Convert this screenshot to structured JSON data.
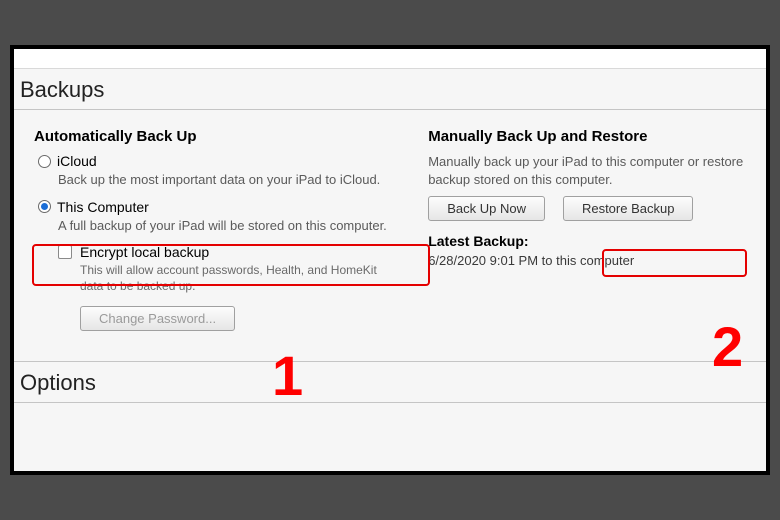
{
  "section_backups": "Backups",
  "section_options": "Options",
  "auto": {
    "heading": "Automatically Back Up",
    "icloud_label": "iCloud",
    "icloud_desc": "Back up the most important data on your iPad to iCloud.",
    "thiscomp_label": "This Computer",
    "thiscomp_desc": "A full backup of your iPad will be stored on this computer.",
    "encrypt_label": "Encrypt local backup",
    "encrypt_desc": "This will allow account passwords, Health, and HomeKit data to be backed up.",
    "change_pw": "Change Password..."
  },
  "manual": {
    "heading": "Manually Back Up and Restore",
    "desc": "Manually back up your iPad to this computer or restore backup stored on this computer.",
    "backup_now": "Back Up Now",
    "restore": "Restore Backup",
    "latest_label": "Latest Backup:",
    "latest_value": "6/28/2020 9:01 PM to this computer"
  },
  "annotations": {
    "one": "1",
    "two": "2"
  }
}
